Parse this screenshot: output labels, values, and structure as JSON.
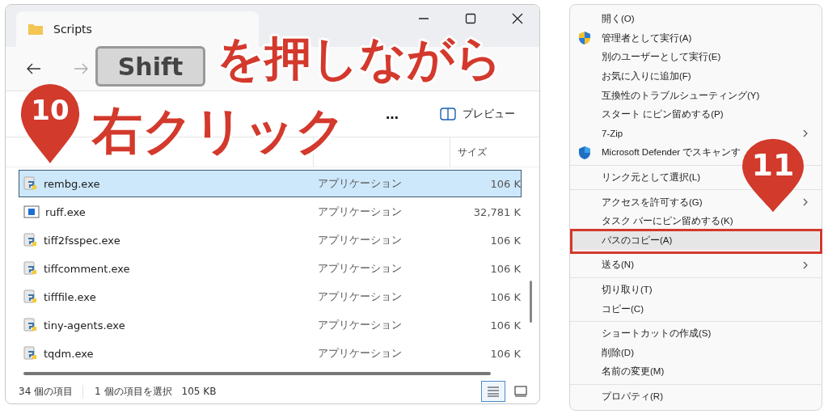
{
  "explorer": {
    "tab_title": "Scripts",
    "toolbar": {
      "more": "…",
      "preview": "プレビュー"
    },
    "size_header": "サイズ",
    "files": [
      {
        "kind": "python",
        "name": "rembg.exe",
        "type": "アプリケーション",
        "size": "106 K",
        "selected": true
      },
      {
        "kind": "app",
        "name": "ruff.exe",
        "type": "アプリケーション",
        "size": "32,781 K",
        "selected": false
      },
      {
        "kind": "python",
        "name": "tiff2fsspec.exe",
        "type": "アプリケーション",
        "size": "106 K",
        "selected": false
      },
      {
        "kind": "python",
        "name": "tiffcomment.exe",
        "type": "アプリケーション",
        "size": "106 K",
        "selected": false
      },
      {
        "kind": "python",
        "name": "tifffile.exe",
        "type": "アプリケーション",
        "size": "106 K",
        "selected": false
      },
      {
        "kind": "python",
        "name": "tiny-agents.exe",
        "type": "アプリケーション",
        "size": "106 K",
        "selected": false
      },
      {
        "kind": "python",
        "name": "tqdm.exe",
        "type": "アプリケーション",
        "size": "106 K",
        "selected": false
      }
    ],
    "status": {
      "count": "34 個の項目",
      "selection": "1 個の項目を選択",
      "selection_size": "105 KB"
    },
    "views": [
      {
        "kind": "details",
        "selected": true
      },
      {
        "kind": "tiles",
        "selected": false
      }
    ]
  },
  "context_menu": [
    {
      "kind": "plain",
      "label": "開く(O)",
      "submenu": false,
      "selected": false
    },
    {
      "kind": "shield",
      "label": "管理者として実行(A)",
      "submenu": false,
      "selected": false
    },
    {
      "kind": "plain",
      "label": "別のユーザーとして実行(E)",
      "submenu": false,
      "selected": false
    },
    {
      "kind": "plain",
      "label": "お気に入りに追加(F)",
      "submenu": false,
      "selected": false
    },
    {
      "kind": "plain",
      "label": "互換性のトラブルシューティング(Y)",
      "submenu": false,
      "selected": false
    },
    {
      "kind": "plain",
      "label": "スタート にピン留めする(P)",
      "submenu": false,
      "selected": false
    },
    {
      "kind": "plain",
      "label": "7-Zip",
      "submenu": true,
      "selected": false
    },
    {
      "kind": "defender",
      "label": "Microsoft Defender でスキャンす",
      "submenu": false,
      "selected": false
    },
    {
      "kind": "separator"
    },
    {
      "kind": "plain",
      "label": "リンク元として選択(L)",
      "submenu": false,
      "selected": false
    },
    {
      "kind": "separator"
    },
    {
      "kind": "plain",
      "label": "アクセスを許可する(G)",
      "submenu": true,
      "selected": false
    },
    {
      "kind": "plain",
      "label": "タスク バーにピン留めする(K)",
      "submenu": false,
      "selected": false
    },
    {
      "kind": "plain",
      "label": "パスのコピー(A)",
      "submenu": false,
      "selected": true
    },
    {
      "kind": "separator"
    },
    {
      "kind": "plain",
      "label": "送る(N)",
      "submenu": true,
      "selected": false
    },
    {
      "kind": "separator"
    },
    {
      "kind": "plain",
      "label": "切り取り(T)",
      "submenu": false,
      "selected": false
    },
    {
      "kind": "plain",
      "label": "コピー(C)",
      "submenu": false,
      "selected": false
    },
    {
      "kind": "separator"
    },
    {
      "kind": "plain",
      "label": "ショートカットの作成(S)",
      "submenu": false,
      "selected": false
    },
    {
      "kind": "plain",
      "label": "削除(D)",
      "submenu": false,
      "selected": false
    },
    {
      "kind": "plain",
      "label": "名前の変更(M)",
      "submenu": false,
      "selected": false
    },
    {
      "kind": "separator"
    },
    {
      "kind": "plain",
      "label": "プロパティ(R)",
      "submenu": false,
      "selected": false
    }
  ],
  "annotations": [
    {
      "kind": "key",
      "text": "Shift"
    },
    {
      "kind": "caption",
      "text": "を押しながら"
    },
    {
      "kind": "pin",
      "text": "10"
    },
    {
      "kind": "caption",
      "text": "右クリック"
    },
    {
      "kind": "pin",
      "text": "11"
    },
    {
      "kind": "frame"
    }
  ]
}
